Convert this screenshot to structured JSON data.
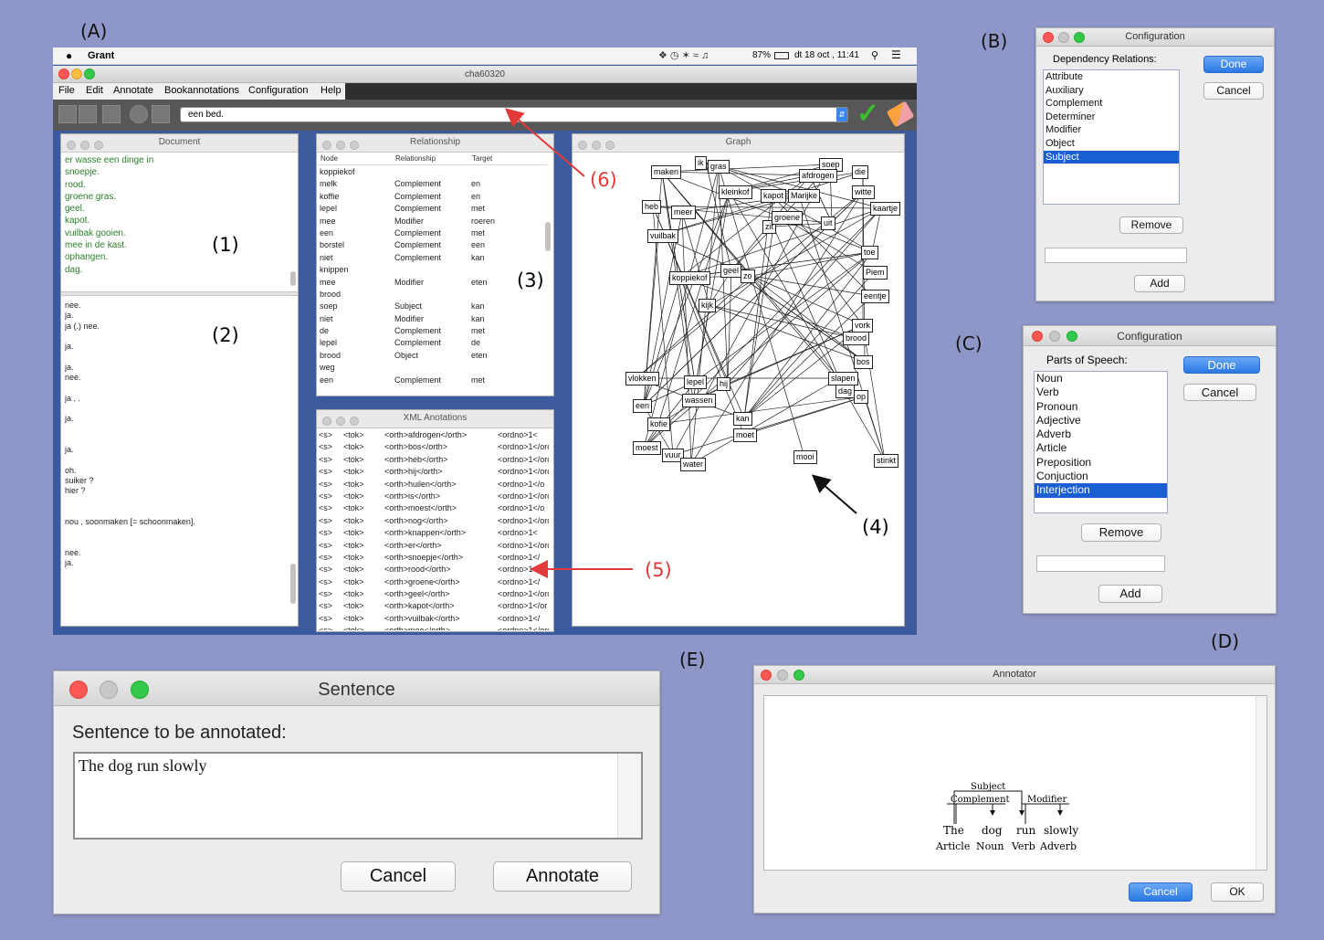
{
  "labels": {
    "A": "(A)",
    "B": "(B)",
    "C": "(C)",
    "D": "(D)",
    "E": "(E)"
  },
  "annotations": {
    "n1": "(1)",
    "n2": "(2)",
    "n3": "(3)",
    "n4": "(4)",
    "n5": "(5)",
    "n6": "(6)"
  },
  "menubar": {
    "app": "Grant",
    "battery": "87%",
    "datetime": "dt 18 oct , 11:41"
  },
  "main_window": {
    "title": "cha60320",
    "menus": [
      "File",
      "Edit",
      "Annotate",
      "Bookannotations",
      "Configuration",
      "Help"
    ],
    "sentence_select": "een bed."
  },
  "document": {
    "title": "Document",
    "upper_lines": [
      "er wasse een dinge in",
      "snoepje.",
      "rood.",
      "groene gras.",
      "geel.",
      "kapot.",
      "vuilbak gooien.",
      "mee in de kast.",
      "ophangen.",
      "dag."
    ],
    "lower_lines": [
      "nee.",
      "ja.",
      "ja (.) nee.",
      "",
      "ja.",
      "",
      "ja.",
      "nee.",
      "",
      "ja ,                    .",
      "",
      "ja.",
      "",
      "",
      "ja.",
      "",
      "oh.",
      "suiker ?",
      "hier ?",
      "",
      "",
      "nou , soonmaken [= schoonmaken].",
      "",
      "",
      "nee.",
      "ja."
    ]
  },
  "relationship": {
    "title": "Relationship",
    "headers": [
      "Node",
      "Relationship",
      "Target"
    ],
    "rows": [
      [
        "koppiekof",
        "",
        ""
      ],
      [
        "melk",
        "Complement",
        "en"
      ],
      [
        "koffie",
        "Complement",
        "en"
      ],
      [
        "lepel",
        "Complement",
        "met"
      ],
      [
        "mee",
        "Modifier",
        "roeren"
      ],
      [
        "een",
        "Complement",
        "met"
      ],
      [
        "borstel",
        "Complement",
        "een"
      ],
      [
        "niet",
        "Complement",
        "kan"
      ],
      [
        "knippen",
        "",
        ""
      ],
      [
        "mee",
        "Modifier",
        "eten"
      ],
      [
        "brood",
        "",
        ""
      ],
      [
        "soep",
        "Subject",
        "kan"
      ],
      [
        "niet",
        "Modifier",
        "kan"
      ],
      [
        "de",
        "Complement",
        "met"
      ],
      [
        "lepel",
        "Complement",
        "de"
      ],
      [
        "brood",
        "Object",
        "eten"
      ],
      [
        "weg",
        "",
        ""
      ],
      [
        "een",
        "Complement",
        "met"
      ]
    ]
  },
  "xml": {
    "title": "XML Anotations",
    "rows": [
      [
        "<s>",
        "<tok>",
        "<orth>afdrogen</orth>",
        "<ordno>1<"
      ],
      [
        "<s>",
        "<tok>",
        "<orth>bos</orth>",
        "<ordno>1</ordr"
      ],
      [
        "<s>",
        "<tok>",
        "<orth>heb</orth>",
        "<ordno>1</ordr"
      ],
      [
        "<s>",
        "<tok>",
        "<orth>hij</orth>",
        "<ordno>1</ordn"
      ],
      [
        "<s>",
        "<tok>",
        "<orth>huilen</orth>",
        "<ordno>1</o"
      ],
      [
        "<s>",
        "<tok>",
        "<orth>is</orth>",
        "<ordno>1</ordno"
      ],
      [
        "<s>",
        "<tok>",
        "<orth>moest</orth>",
        "<ordno>1</o"
      ],
      [
        "<s>",
        "<tok>",
        "<orth>nog</orth>",
        "<ordno>1</ordr"
      ],
      [
        "<s>",
        "<tok>",
        "<orth>knappen</orth>",
        "<ordno>1<"
      ],
      [
        "<s>",
        "<tok>",
        "<orth>er</orth>",
        "<ordno>1</ordno"
      ],
      [
        "<s>",
        "<tok>",
        "<orth>snoepje</orth>",
        "<ordno>1</"
      ],
      [
        "<s>",
        "<tok>",
        "<orth>rood</orth>",
        "<ordno>1</o"
      ],
      [
        "<s>",
        "<tok>",
        "<orth>groene</orth>",
        "<ordno>1</"
      ],
      [
        "<s>",
        "<tok>",
        "<orth>geel</orth>",
        "<ordno>1</ord"
      ],
      [
        "<s>",
        "<tok>",
        "<orth>kapot</orth>",
        "<ordno>1</or"
      ],
      [
        "<s>",
        "<tok>",
        "<orth>vuilbak</orth>",
        "<ordno>1</"
      ],
      [
        "<s>",
        "<tok>",
        "<orth>mee</orth>",
        "<ordno>1</ord"
      ]
    ]
  },
  "graph": {
    "title": "Graph",
    "nodes": [
      "soep",
      "die",
      "afdrogen",
      "maken",
      "ik",
      "gras",
      "witte",
      "kleinkof",
      "kapot",
      "Marijke",
      "kaartje",
      "heb",
      "meer",
      "zit",
      "groene",
      "uit",
      "vuilbak",
      "geel",
      "zo",
      "toe",
      "kijk",
      "koppiekof",
      "eentje",
      "vork",
      "brood",
      "bos",
      "dag",
      "op",
      "een",
      "kofie",
      "moet",
      "moest",
      "vuur",
      "water",
      "mooi",
      "stinkt",
      "vlokken",
      "lepel",
      "hij",
      "slapen",
      "Piem",
      "kan",
      "wassen"
    ]
  },
  "config_b": {
    "title": "Configuration",
    "heading": "Dependency Relations:",
    "items": [
      "Attribute",
      "Auxiliary",
      "Complement",
      "Determiner",
      "Modifier",
      "Object",
      "Subject"
    ],
    "selected": "Subject",
    "done": "Done",
    "cancel": "Cancel",
    "remove": "Remove",
    "add": "Add"
  },
  "config_c": {
    "title": "Configuration",
    "heading": "Parts of Speech:",
    "items": [
      "Noun",
      "Verb",
      "Pronoun",
      "Adjective",
      "Adverb",
      "Article",
      "Preposition",
      "Conjuction",
      "Interjection"
    ],
    "selected": "Interjection",
    "done": "Done",
    "cancel": "Cancel",
    "remove": "Remove",
    "add": "Add"
  },
  "annotator": {
    "title": "Annotator",
    "relations": {
      "subject": "Subject",
      "complement": "Complement",
      "modifier": "Modifier"
    },
    "words": [
      "The",
      "dog",
      "run",
      "slowly"
    ],
    "pos": [
      "Article",
      "Noun",
      "Verb",
      "Adverb"
    ],
    "cancel": "Cancel",
    "ok": "OK"
  },
  "sentence_dialog": {
    "title": "Sentence",
    "prompt": "Sentence to be annotated:",
    "value": "The dog run slowly",
    "cancel": "Cancel",
    "annotate": "Annotate"
  }
}
